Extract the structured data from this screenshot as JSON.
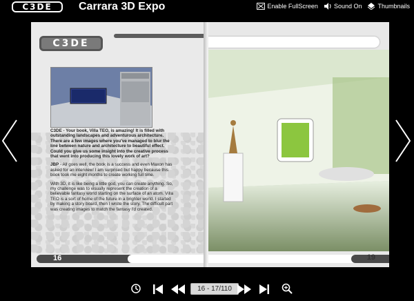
{
  "header": {
    "logo_text": "C3DE",
    "title": "Carrara 3D Expo",
    "actions": [
      {
        "label": "Enable FullScreen",
        "icon": "fullscreen-icon"
      },
      {
        "label": "Sound On",
        "icon": "speaker-icon"
      },
      {
        "label": "Thumbnails",
        "icon": "thumbnails-icon"
      }
    ]
  },
  "book": {
    "left_page": {
      "logo_text": "C3DE",
      "page_number": "16",
      "paragraphs": [
        {
          "lead": "C3DE",
          "text": " - Your book, Villa TEO, is amazing! It is filled with outstanding landscapes and adventurous architecture. There are a few images where you've managed to blur the line between nature and architecture to beautiful effect. Could you give us some insight into the creative process that went into producing this lovely work of art?"
        },
        {
          "lead": "JBP",
          "text": " - All goes well, the book is a success and even Maxon has asked for an interview! I am surprised but happy because this book took me eight months to create working full time."
        },
        {
          "lead": "",
          "text": "With 3D, it is like being a little god, you can create anything. So, my challenge was to visually represent the creation of a believable fantasy world starting on the surface of an atom. Villa TEO is a sort of home of the future in a brighter world. I started by making a story board, then I wrote the story. The difficult part was creating images to match the fantasy I'd created."
        }
      ]
    },
    "right_page": {
      "page_number": "19"
    }
  },
  "toolbar": {
    "page_indicator": "16 - 17/110",
    "buttons": [
      "help-icon",
      "first-page-icon",
      "previous-page-icon",
      "next-page-icon",
      "last-page-icon",
      "zoom-in-icon"
    ]
  },
  "colors": {
    "background": "#000000",
    "accent_green": "#8cc63f"
  }
}
